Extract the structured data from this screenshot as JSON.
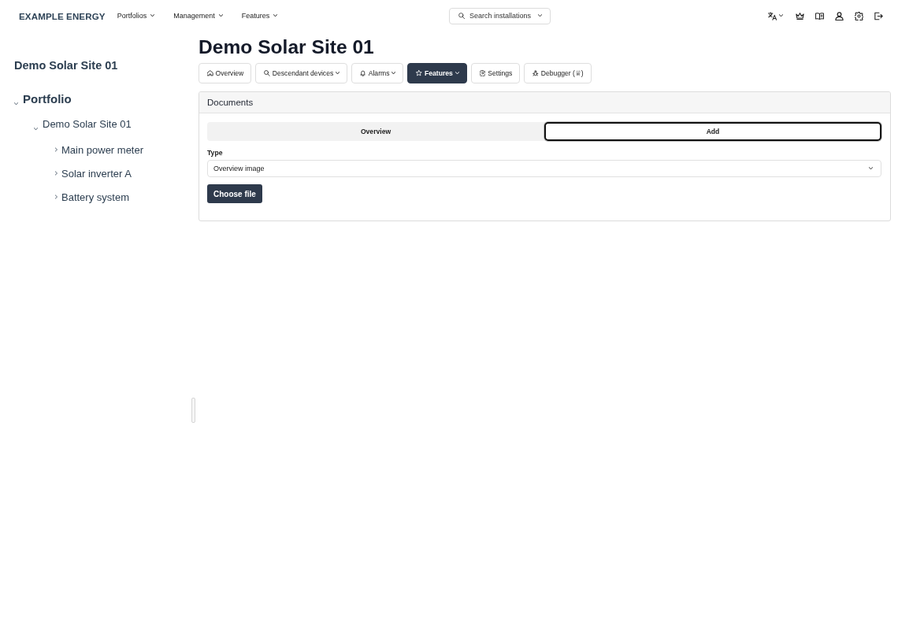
{
  "header": {
    "logo": "EXAMPLE ENERGY",
    "menus": [
      {
        "label": "Portfolios"
      },
      {
        "label": "Management"
      },
      {
        "label": "Features"
      }
    ],
    "search": {
      "label": "Search installations"
    }
  },
  "sidebar": {
    "title": "Demo Solar Site 01",
    "tree": [
      {
        "label": "Portfolio",
        "expanded": true,
        "children": [
          {
            "label": "Demo Solar Site 01",
            "expanded": true,
            "children": [
              {
                "label": "Main power meter",
                "expanded": false
              },
              {
                "label": "Solar inverter A",
                "expanded": false
              },
              {
                "label": "Battery system",
                "expanded": false
              }
            ]
          }
        ]
      }
    ]
  },
  "page": {
    "title": "Demo Solar Site 01",
    "tabs": [
      {
        "label": "Overview",
        "selected": false,
        "has_menu": false
      },
      {
        "label": "Descendant devices",
        "selected": false,
        "has_menu": true
      },
      {
        "label": "Alarms",
        "selected": false,
        "has_menu": true
      },
      {
        "label": "Features",
        "selected": true,
        "has_menu": true
      },
      {
        "label": "Settings",
        "selected": false,
        "has_menu": false
      },
      {
        "label": "Debugger (♕)",
        "selected": false,
        "has_menu": false
      }
    ]
  },
  "documents": {
    "title": "Documents",
    "segments": [
      {
        "label": "Overview",
        "selected": false
      },
      {
        "label": "Add",
        "selected": true
      }
    ],
    "type_field": {
      "label": "Type",
      "value": "Overview image"
    },
    "upload_button": "Choose file"
  }
}
